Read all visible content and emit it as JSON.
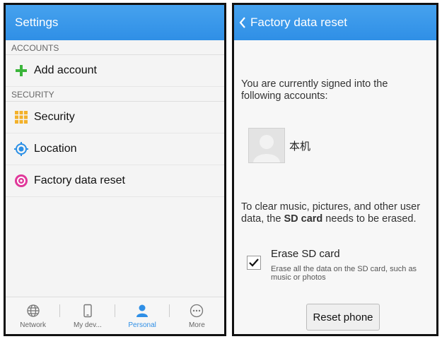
{
  "left": {
    "title": "Settings",
    "sections": {
      "accounts": "ACCOUNTS",
      "security": "SECURITY"
    },
    "items": {
      "add_account": "Add account",
      "security": "Security",
      "location": "Location",
      "factory_reset": "Factory data reset"
    },
    "tabs": [
      "Network",
      "My dev...",
      "Personal",
      "More"
    ],
    "active_tab": "Personal"
  },
  "right": {
    "title": "Factory data reset",
    "signed_in_text": "You are currently signed into the following accounts:",
    "account_name": "本机",
    "clear_text_before": "To clear music, pictures, and other user data, the ",
    "clear_text_bold": "SD card",
    "clear_text_after": " needs to be erased.",
    "erase_title": "Erase SD card",
    "erase_desc": "Erase all the data on the SD card, such as music or photos",
    "erase_checked": true,
    "reset_button": "Reset phone"
  },
  "colors": {
    "appbar": "#2f8fe6",
    "accent_green": "#3bb53b",
    "security_icon": "#f3b12a",
    "location_icon": "#2a8fe6",
    "reset_icon": "#e0389a"
  }
}
